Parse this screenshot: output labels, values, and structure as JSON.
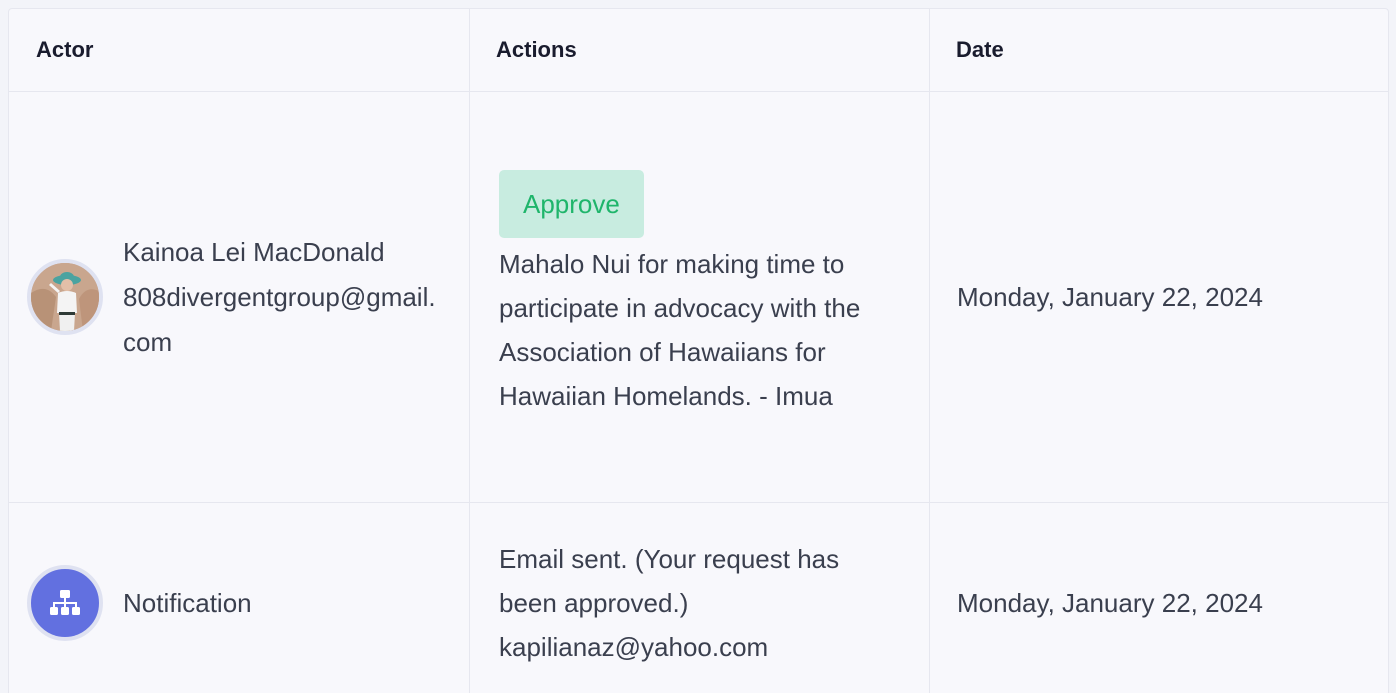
{
  "table": {
    "headers": {
      "actor": "Actor",
      "actions": "Actions",
      "date": "Date"
    },
    "rows": [
      {
        "actor_name": "Kainoa Lei MacDonald",
        "actor_email": "808divergentgroup@gmail.com",
        "avatar_icon": "user-photo",
        "badge": "Approve",
        "action_text": "Mahalo Nui for making time to participate in advocacy with the Association of Hawaiians for Hawaiian Homelands. - Imua",
        "date": "Monday, January 22, 2024"
      },
      {
        "actor_name": "Notification",
        "avatar_icon": "sitemap-icon",
        "action_text": "Email sent. (Your request has been approved.) kapilianaz@yahoo.com",
        "date": "Monday, January 22, 2024"
      }
    ]
  },
  "colors": {
    "badge_bg": "#c8ece0",
    "badge_text": "#1fb56b",
    "notification_avatar": "#6270e0"
  }
}
